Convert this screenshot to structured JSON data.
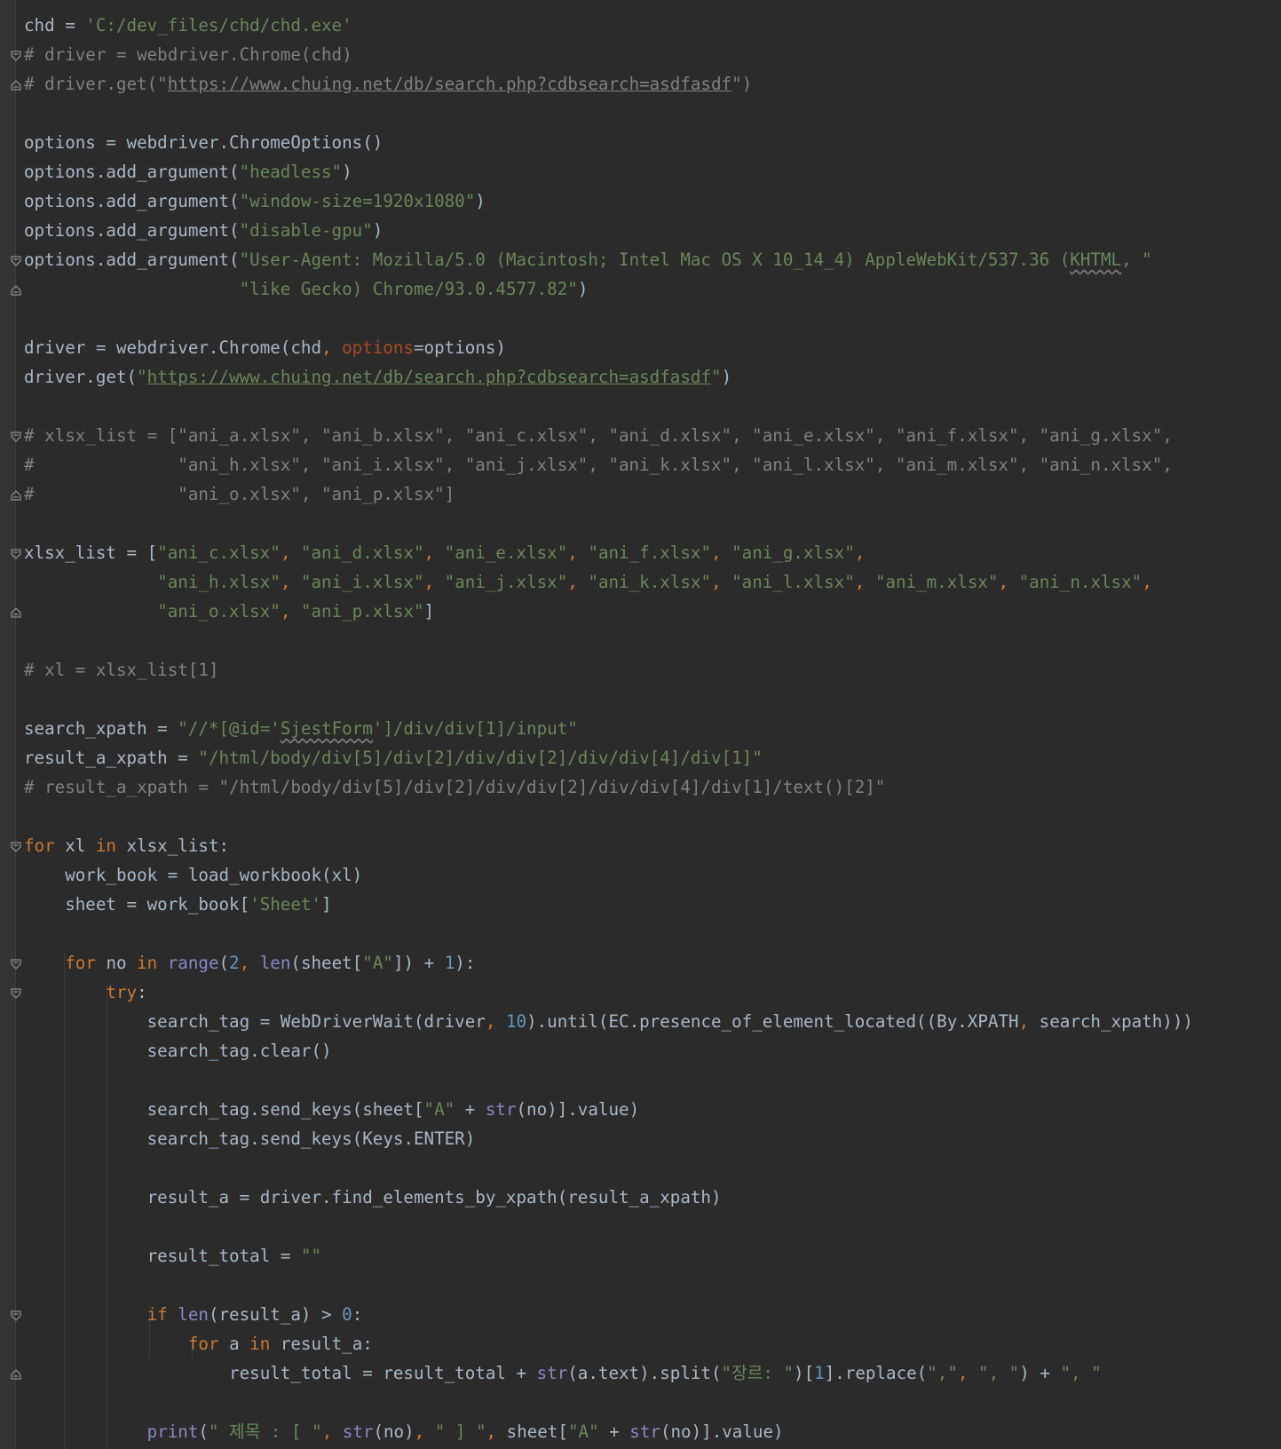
{
  "colors": {
    "background": "#2b2b2b",
    "gutter": "#313335",
    "default": "#a9b7c6",
    "keyword": "#cc7832",
    "string": "#6a8759",
    "comment": "#808080",
    "number": "#6897bb",
    "builtin": "#8888c6",
    "parameter": "#aa4926"
  },
  "editor": {
    "language": "python",
    "lines": [
      [
        [
          "d",
          "chd = "
        ],
        [
          "s",
          "'C:/dev_files/chd/chd.exe'"
        ]
      ],
      [
        [
          "c",
          "# driver = webdriver.Chrome(chd)"
        ]
      ],
      [
        [
          "c",
          "# driver.get(\""
        ],
        [
          "cu",
          "https://www.chuing.net/db/search.php?cdbsearch=asdfasdf"
        ],
        [
          "c",
          "\")"
        ]
      ],
      [],
      [
        [
          "d",
          "options = webdriver.ChromeOptions()"
        ]
      ],
      [
        [
          "d",
          "options.add_argument("
        ],
        [
          "s",
          "\"headless\""
        ],
        [
          "d",
          ")"
        ]
      ],
      [
        [
          "d",
          "options.add_argument("
        ],
        [
          "s",
          "\"window-size=1920x1080\""
        ],
        [
          "d",
          ")"
        ]
      ],
      [
        [
          "d",
          "options.add_argument("
        ],
        [
          "s",
          "\"disable-gpu\""
        ],
        [
          "d",
          ")"
        ]
      ],
      [
        [
          "d",
          "options.add_argument("
        ],
        [
          "s",
          "\"User-Agent: Mozilla/5.0 (Macintosh; Intel Mac OS X 10_14_4) AppleWebKit/537.36 ("
        ],
        [
          "sq",
          "KHTML"
        ],
        [
          "s",
          ", \""
        ]
      ],
      [
        [
          "d",
          "                     "
        ],
        [
          "s",
          "\"like Gecko) Chrome/93.0.4577.82\""
        ],
        [
          "d",
          ")"
        ]
      ],
      [],
      [
        [
          "d",
          "driver = webdriver.Chrome(chd"
        ],
        [
          "k",
          ", "
        ],
        [
          "p",
          "options"
        ],
        [
          "d",
          "=options)"
        ]
      ],
      [
        [
          "d",
          "driver.get("
        ],
        [
          "s",
          "\""
        ],
        [
          "su",
          "https://www.chuing.net/db/search.php?cdbsearch=asdfasdf"
        ],
        [
          "s",
          "\""
        ],
        [
          "d",
          ")"
        ]
      ],
      [],
      [
        [
          "c",
          "# xlsx_list = [\"ani_a.xlsx\", \"ani_b.xlsx\", \"ani_c.xlsx\", \"ani_d.xlsx\", \"ani_e.xlsx\", \"ani_f.xlsx\", \"ani_g.xlsx\","
        ]
      ],
      [
        [
          "c",
          "#              \"ani_h.xlsx\", \"ani_i.xlsx\", \"ani_j.xlsx\", \"ani_k.xlsx\", \"ani_l.xlsx\", \"ani_m.xlsx\", \"ani_n.xlsx\","
        ]
      ],
      [
        [
          "c",
          "#              \"ani_o.xlsx\", \"ani_p.xlsx\"]"
        ]
      ],
      [],
      [
        [
          "d",
          "xlsx_list = ["
        ],
        [
          "s",
          "\"ani_c.xlsx\""
        ],
        [
          "k",
          ", "
        ],
        [
          "s",
          "\"ani_d.xlsx\""
        ],
        [
          "k",
          ", "
        ],
        [
          "s",
          "\"ani_e.xlsx\""
        ],
        [
          "k",
          ", "
        ],
        [
          "s",
          "\"ani_f.xlsx\""
        ],
        [
          "k",
          ", "
        ],
        [
          "s",
          "\"ani_g.xlsx\""
        ],
        [
          "k",
          ","
        ]
      ],
      [
        [
          "d",
          "             "
        ],
        [
          "s",
          "\"ani_h.xlsx\""
        ],
        [
          "k",
          ", "
        ],
        [
          "s",
          "\"ani_i.xlsx\""
        ],
        [
          "k",
          ", "
        ],
        [
          "s",
          "\"ani_j.xlsx\""
        ],
        [
          "k",
          ", "
        ],
        [
          "s",
          "\"ani_k.xlsx\""
        ],
        [
          "k",
          ", "
        ],
        [
          "s",
          "\"ani_l.xlsx\""
        ],
        [
          "k",
          ", "
        ],
        [
          "s",
          "\"ani_m.xlsx\""
        ],
        [
          "k",
          ", "
        ],
        [
          "s",
          "\"ani_n.xlsx\""
        ],
        [
          "k",
          ","
        ]
      ],
      [
        [
          "d",
          "             "
        ],
        [
          "s",
          "\"ani_o.xlsx\""
        ],
        [
          "k",
          ", "
        ],
        [
          "s",
          "\"ani_p.xlsx\""
        ],
        [
          "d",
          "]"
        ]
      ],
      [],
      [
        [
          "c",
          "# xl = xlsx_list[1]"
        ]
      ],
      [],
      [
        [
          "d",
          "search_xpath = "
        ],
        [
          "s",
          "\"//*[@id='"
        ],
        [
          "sq",
          "SjestForm"
        ],
        [
          "s",
          "']/div/div[1]/input\""
        ]
      ],
      [
        [
          "d",
          "result_a_xpath = "
        ],
        [
          "s",
          "\"/html/body/div[5]/div[2]/div/div[2]/div/div[4]/div[1]\""
        ]
      ],
      [
        [
          "c",
          "# result_a_xpath = \"/html/body/div[5]/div[2]/div/div[2]/div/div[4]/div[1]/text()[2]\""
        ]
      ],
      [],
      [
        [
          "k",
          "for "
        ],
        [
          "d",
          "xl "
        ],
        [
          "k",
          "in "
        ],
        [
          "d",
          "xlsx_list:"
        ]
      ],
      [
        [
          "d",
          "    work_book = load_workbook(xl)"
        ]
      ],
      [
        [
          "d",
          "    sheet = work_book["
        ],
        [
          "s",
          "'Sheet'"
        ],
        [
          "d",
          "]"
        ]
      ],
      [],
      [
        [
          "d",
          "    "
        ],
        [
          "k",
          "for "
        ],
        [
          "d",
          "no "
        ],
        [
          "k",
          "in "
        ],
        [
          "b",
          "range"
        ],
        [
          "d",
          "("
        ],
        [
          "n",
          "2"
        ],
        [
          "k",
          ", "
        ],
        [
          "b",
          "len"
        ],
        [
          "d",
          "(sheet["
        ],
        [
          "s",
          "\"A\""
        ],
        [
          "d",
          "]) + "
        ],
        [
          "n",
          "1"
        ],
        [
          "d",
          "):"
        ]
      ],
      [
        [
          "d",
          "        "
        ],
        [
          "k",
          "try"
        ],
        [
          "d",
          ":"
        ]
      ],
      [
        [
          "d",
          "            search_tag = WebDriverWait(driver"
        ],
        [
          "k",
          ", "
        ],
        [
          "n",
          "10"
        ],
        [
          "d",
          ").until(EC.presence_of_element_located((By.XPATH"
        ],
        [
          "k",
          ", "
        ],
        [
          "d",
          "search_xpath)))"
        ]
      ],
      [
        [
          "d",
          "            search_tag.clear()"
        ]
      ],
      [],
      [
        [
          "d",
          "            search_tag.send_keys(sheet["
        ],
        [
          "s",
          "\"A\""
        ],
        [
          "d",
          " + "
        ],
        [
          "b",
          "str"
        ],
        [
          "d",
          "(no)].value)"
        ]
      ],
      [
        [
          "d",
          "            search_tag.send_keys(Keys.ENTER)"
        ]
      ],
      [],
      [
        [
          "d",
          "            result_a = driver.find_elements_by_xpath(result_a_xpath)"
        ]
      ],
      [],
      [
        [
          "d",
          "            result_total = "
        ],
        [
          "s",
          "\"\""
        ]
      ],
      [],
      [
        [
          "d",
          "            "
        ],
        [
          "k",
          "if "
        ],
        [
          "b",
          "len"
        ],
        [
          "d",
          "(result_a) > "
        ],
        [
          "n",
          "0"
        ],
        [
          "d",
          ":"
        ]
      ],
      [
        [
          "d",
          "                "
        ],
        [
          "k",
          "for "
        ],
        [
          "d",
          "a "
        ],
        [
          "k",
          "in "
        ],
        [
          "d",
          "result_a:"
        ]
      ],
      [
        [
          "d",
          "                    result_total = result_total + "
        ],
        [
          "b",
          "str"
        ],
        [
          "d",
          "(a.text).split("
        ],
        [
          "s",
          "\"장르: \""
        ],
        [
          "d",
          ")["
        ],
        [
          "n",
          "1"
        ],
        [
          "d",
          "].replace("
        ],
        [
          "s",
          "\",\""
        ],
        [
          "k",
          ", "
        ],
        [
          "s",
          "\", \""
        ],
        [
          "d",
          ") + "
        ],
        [
          "s",
          "\", \""
        ]
      ],
      [],
      [
        [
          "d",
          "            "
        ],
        [
          "b",
          "print"
        ],
        [
          "d",
          "("
        ],
        [
          "s",
          "\" 제목 : [ \""
        ],
        [
          "k",
          ", "
        ],
        [
          "b",
          "str"
        ],
        [
          "d",
          "(no)"
        ],
        [
          "k",
          ", "
        ],
        [
          "s",
          "\" ] \""
        ],
        [
          "k",
          ", "
        ],
        [
          "d",
          "sheet["
        ],
        [
          "s",
          "\"A\""
        ],
        [
          "d",
          " + "
        ],
        [
          "b",
          "str"
        ],
        [
          "d",
          "(no)].value)"
        ]
      ]
    ]
  }
}
